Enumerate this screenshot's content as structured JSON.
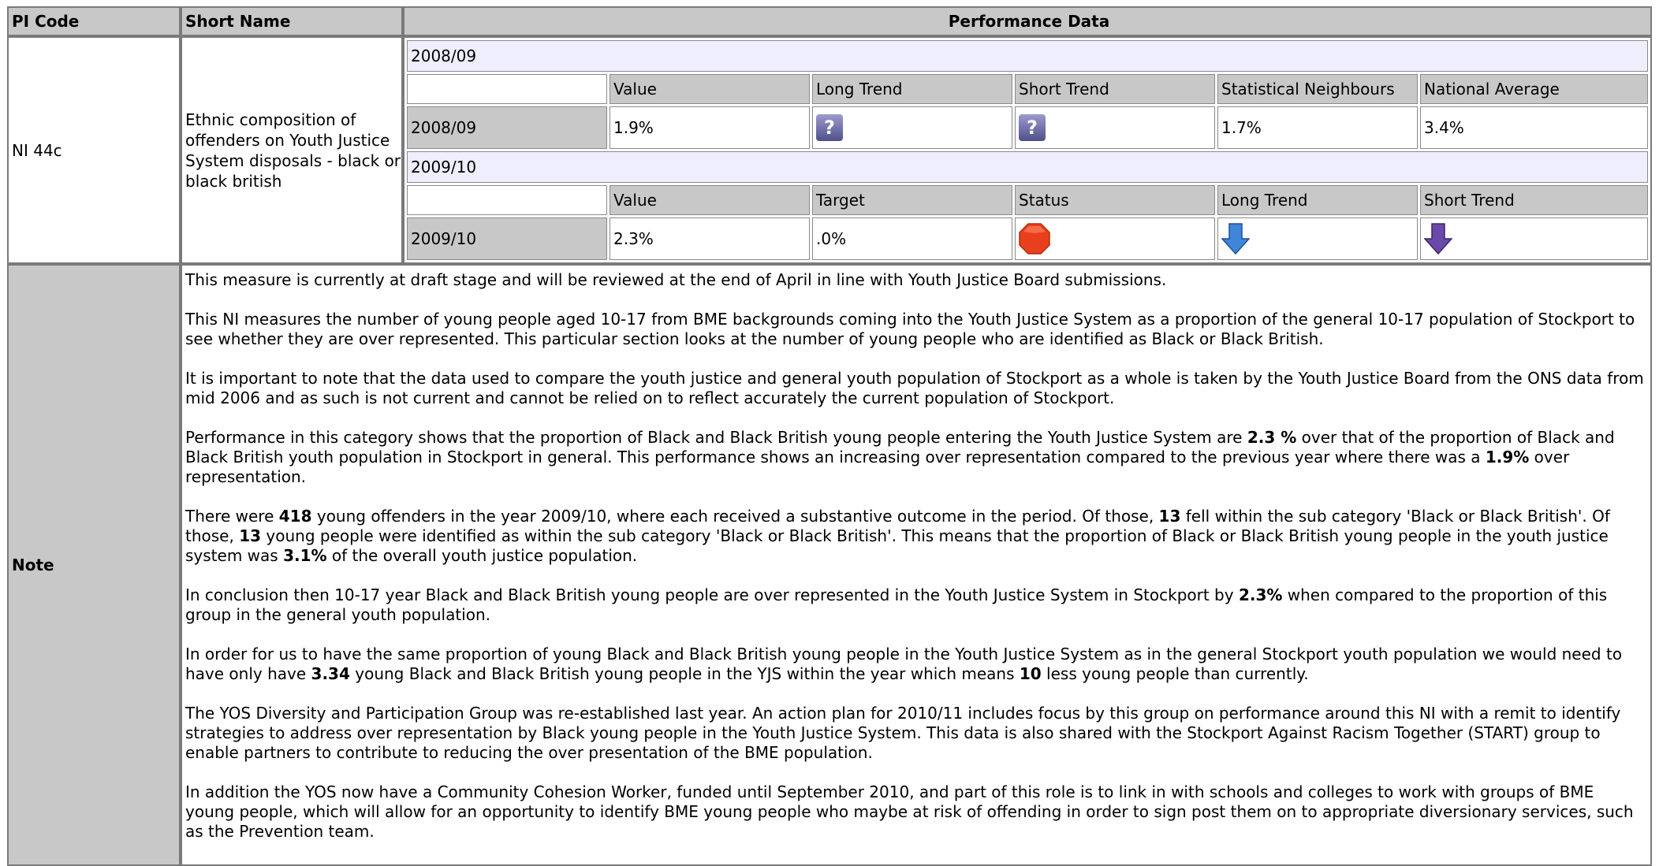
{
  "header": {
    "pi_code": "PI Code",
    "short_name": "Short Name",
    "performance_data": "Performance Data"
  },
  "indicator": {
    "code": "NI 44c",
    "short_name": "Ethnic composition of offenders on Youth Justice System disposals - black or black british"
  },
  "period_2008": {
    "year_label": "2008/09",
    "columns": [
      "Value",
      "Long Trend",
      "Short Trend",
      "Statistical Neighbours",
      "National Average"
    ],
    "row_label": "2008/09",
    "value": "1.9%",
    "long_trend_icon": "unknown-trend-icon",
    "short_trend_icon": "unknown-trend-icon",
    "statistical_neighbours": "1.7%",
    "national_average": "3.4%"
  },
  "period_2009": {
    "year_label": "2009/10",
    "columns": [
      "Value",
      "Target",
      "Status",
      "Long Trend",
      "Short Trend"
    ],
    "row_label": "2009/10",
    "value": "2.3%",
    "target": ".0%",
    "status_icon": "red-octagon-icon",
    "long_trend_icon": "blue-down-arrow-icon",
    "short_trend_icon": "purple-down-arrow-icon"
  },
  "note": {
    "label": "Note",
    "p1": "This measure is currently at draft stage and will be reviewed at the end of April in line with Youth Justice Board submissions.",
    "p2": "This NI measures the number of young people aged 10-17 from BME backgrounds coming into the Youth Justice System as a proportion of the general 10-17 population of Stockport to see whether they are over represented. This particular section looks at the number of young people who are identified as Black or Black British.",
    "p3": "It is important to note that the data used to compare the youth justice and general youth population of Stockport as a whole is taken by the Youth Justice Board from the ONS data from mid 2006 and as such is not current and cannot be relied on to reflect accurately the current population of Stockport.",
    "p4a": "Performance in this category shows that the proportion of Black and Black British young people entering the Youth Justice System are ",
    "p4b": "2.3 %",
    "p4c": " over that of the proportion of Black and Black British youth population in Stockport in general. This performance shows an increasing over representation compared to the previous year where there was a ",
    "p4d": "1.9%",
    "p4e": " over representation.",
    "p5a": "There were ",
    "p5b": "418",
    "p5c": " young offenders in the year 2009/10, where each received a substantive outcome in the period. Of those, ",
    "p5d": "13",
    "p5e": " fell within the sub category 'Black or Black British'. Of those, ",
    "p5f": "13",
    "p5g": " young people were identified as within the sub category 'Black or Black British'. This means that the proportion of Black or Black British young people in the youth justice system was ",
    "p5h": "3.1%",
    "p5i": " of the overall youth justice population.",
    "p6a": "In conclusion then 10-17 year Black and Black British young people are over represented in the Youth Justice System in Stockport by ",
    "p6b": "2.3%",
    "p6c": " when compared to the proportion of this group in the general youth population.",
    "p7a": "In order for us to have the same proportion of young Black and Black British young people in the Youth Justice System as in the general Stockport youth population we would need to have only have ",
    "p7b": "3.34",
    "p7c": " young Black and Black British young people in the YJS within the year which means ",
    "p7d": "10",
    "p7e": " less young people than currently.",
    "p8": "The YOS Diversity and Participation Group was re-established last year. An action plan for 2010/11 includes focus by this group on performance around this NI with a remit to identify strategies to address over representation by Black young people in the Youth Justice System. This data is also shared with the Stockport Against Racism Together (START) group to enable partners to contribute to reducing the over presentation of the BME population.",
    "p9": "In addition the YOS now have a Community Cohesion Worker, funded until September 2010, and part of this role is to link in with schools and colleges to work with groups of BME young people, which will allow for an opportunity to identify BME young people who maybe at risk of offending in order to sign post them on to appropriate diversionary services, such as the Prevention team."
  },
  "colors": {
    "header_bg": "#c8c8c8",
    "year_row_bg": "#eeeeff",
    "status_red": "#e8401c",
    "trend_blue": "#3f86d8",
    "trend_purple": "#6a4aa8"
  }
}
